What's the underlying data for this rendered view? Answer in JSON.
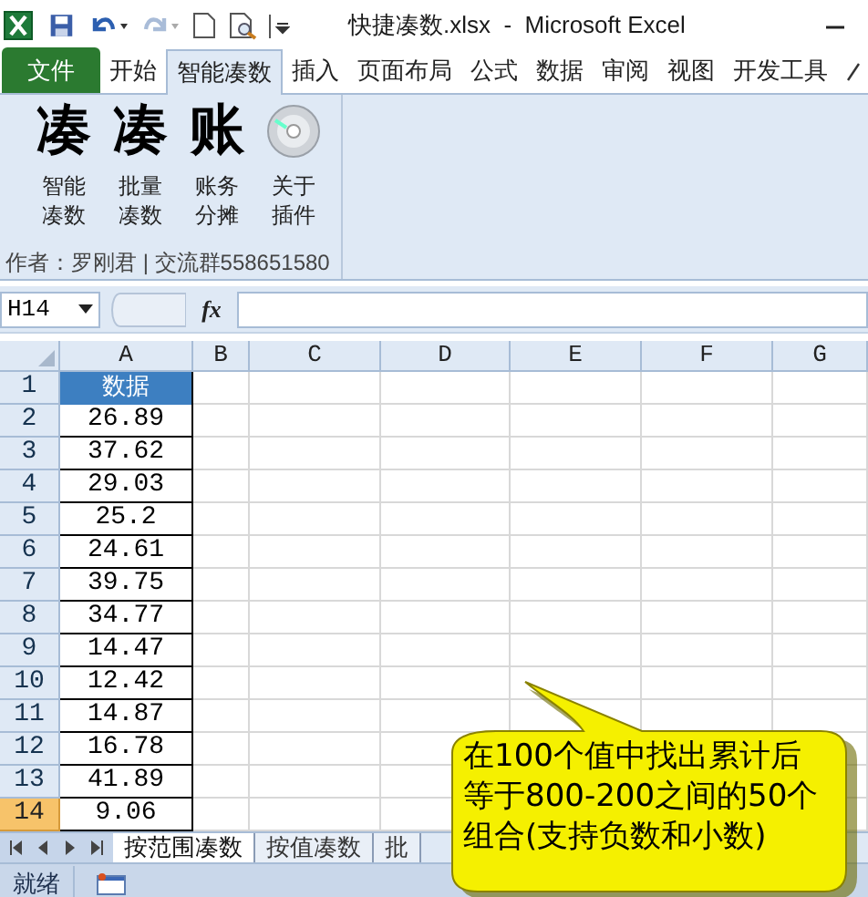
{
  "window": {
    "title": "快捷凑数.xlsx  -  Microsoft Excel"
  },
  "tabs": [
    {
      "label": "文件",
      "kind": "file",
      "selected": false
    },
    {
      "label": "开始",
      "kind": "tab",
      "selected": false
    },
    {
      "label": "智能凑数",
      "kind": "tab",
      "selected": true
    },
    {
      "label": "插入",
      "kind": "tab",
      "selected": false
    },
    {
      "label": "页面布局",
      "kind": "tab",
      "selected": false
    },
    {
      "label": "公式",
      "kind": "tab",
      "selected": false
    },
    {
      "label": "数据",
      "kind": "tab",
      "selected": false
    },
    {
      "label": "审阅",
      "kind": "tab",
      "selected": false
    },
    {
      "label": "视图",
      "kind": "tab",
      "selected": false
    },
    {
      "label": "开发工具",
      "kind": "tab",
      "selected": false
    }
  ],
  "ribbon": {
    "buttons": [
      {
        "kind": "glyph",
        "glyph": "凑",
        "label": [
          "智能",
          "凑数"
        ]
      },
      {
        "kind": "glyph",
        "glyph": "凑",
        "label": [
          "批量",
          "凑数"
        ]
      },
      {
        "kind": "glyph",
        "glyph": "账",
        "label": [
          "账务",
          "分摊"
        ]
      },
      {
        "kind": "disc",
        "label": [
          "关于",
          "插件"
        ]
      }
    ],
    "author": "作者：罗刚君 | 交流群558651580"
  },
  "formula_bar": {
    "name_box": "H14",
    "fx": "fx"
  },
  "columns": [
    {
      "label": "A"
    },
    {
      "label": "B"
    },
    {
      "label": "C"
    },
    {
      "label": "D"
    },
    {
      "label": "E"
    },
    {
      "label": "F"
    },
    {
      "label": "G"
    }
  ],
  "rows": [
    {
      "header": "1",
      "value": "数据",
      "kind": "heading",
      "selected": false
    },
    {
      "header": "2",
      "value": "26.89",
      "kind": "value",
      "selected": false
    },
    {
      "header": "3",
      "value": "37.62",
      "kind": "value",
      "selected": false
    },
    {
      "header": "4",
      "value": "29.03",
      "kind": "value",
      "selected": false
    },
    {
      "header": "5",
      "value": "25.2",
      "kind": "value",
      "selected": false
    },
    {
      "header": "6",
      "value": "24.61",
      "kind": "value",
      "selected": false
    },
    {
      "header": "7",
      "value": "39.75",
      "kind": "value",
      "selected": false
    },
    {
      "header": "8",
      "value": "34.77",
      "kind": "value",
      "selected": false
    },
    {
      "header": "9",
      "value": "14.47",
      "kind": "value",
      "selected": false
    },
    {
      "header": "10",
      "value": "12.42",
      "kind": "value",
      "selected": false
    },
    {
      "header": "11",
      "value": "14.87",
      "kind": "value",
      "selected": false
    },
    {
      "header": "12",
      "value": "16.78",
      "kind": "value",
      "selected": false
    },
    {
      "header": "13",
      "value": "41.89",
      "kind": "value",
      "selected": false
    },
    {
      "header": "14",
      "value": "9.06",
      "kind": "value",
      "selected": true
    }
  ],
  "sheet_tabs": [
    {
      "label": "按范围凑数",
      "selected": true
    },
    {
      "label": "按值凑数",
      "selected": false
    },
    {
      "label": "批",
      "selected": false
    }
  ],
  "status_bar": {
    "text": "就绪"
  },
  "callout": {
    "lines": [
      "在100个值中找出累计后",
      "等于800-200之间的50个",
      "组合(支持负数和小数)"
    ]
  }
}
